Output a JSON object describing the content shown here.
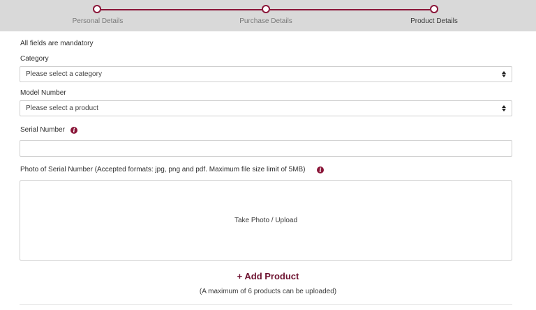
{
  "stepper": {
    "steps": [
      {
        "label": "Personal Details"
      },
      {
        "label": "Purchase Details"
      },
      {
        "label": "Product Details"
      }
    ],
    "active_step": 3
  },
  "form": {
    "mandatory_note": "All fields are mandatory",
    "category": {
      "label": "Category",
      "value": "Please select a category"
    },
    "model_number": {
      "label": "Model Number",
      "value": "Please select a product"
    },
    "serial_number": {
      "label": "Serial Number",
      "value": ""
    },
    "photo": {
      "label": "Photo of Serial Number (Accepted formats: jpg, png and pdf. Maximum file size limit of 5MB)",
      "upload_text": "Take Photo / Upload"
    },
    "add_product_label": "+ Add Product",
    "max_note": "(A maximum of 6 products can be uploaded)"
  },
  "icons": {
    "info": "i"
  },
  "colors": {
    "accent": "#8a1538",
    "stepper_bg": "#d9d9d9",
    "border": "#cfcfcf"
  }
}
